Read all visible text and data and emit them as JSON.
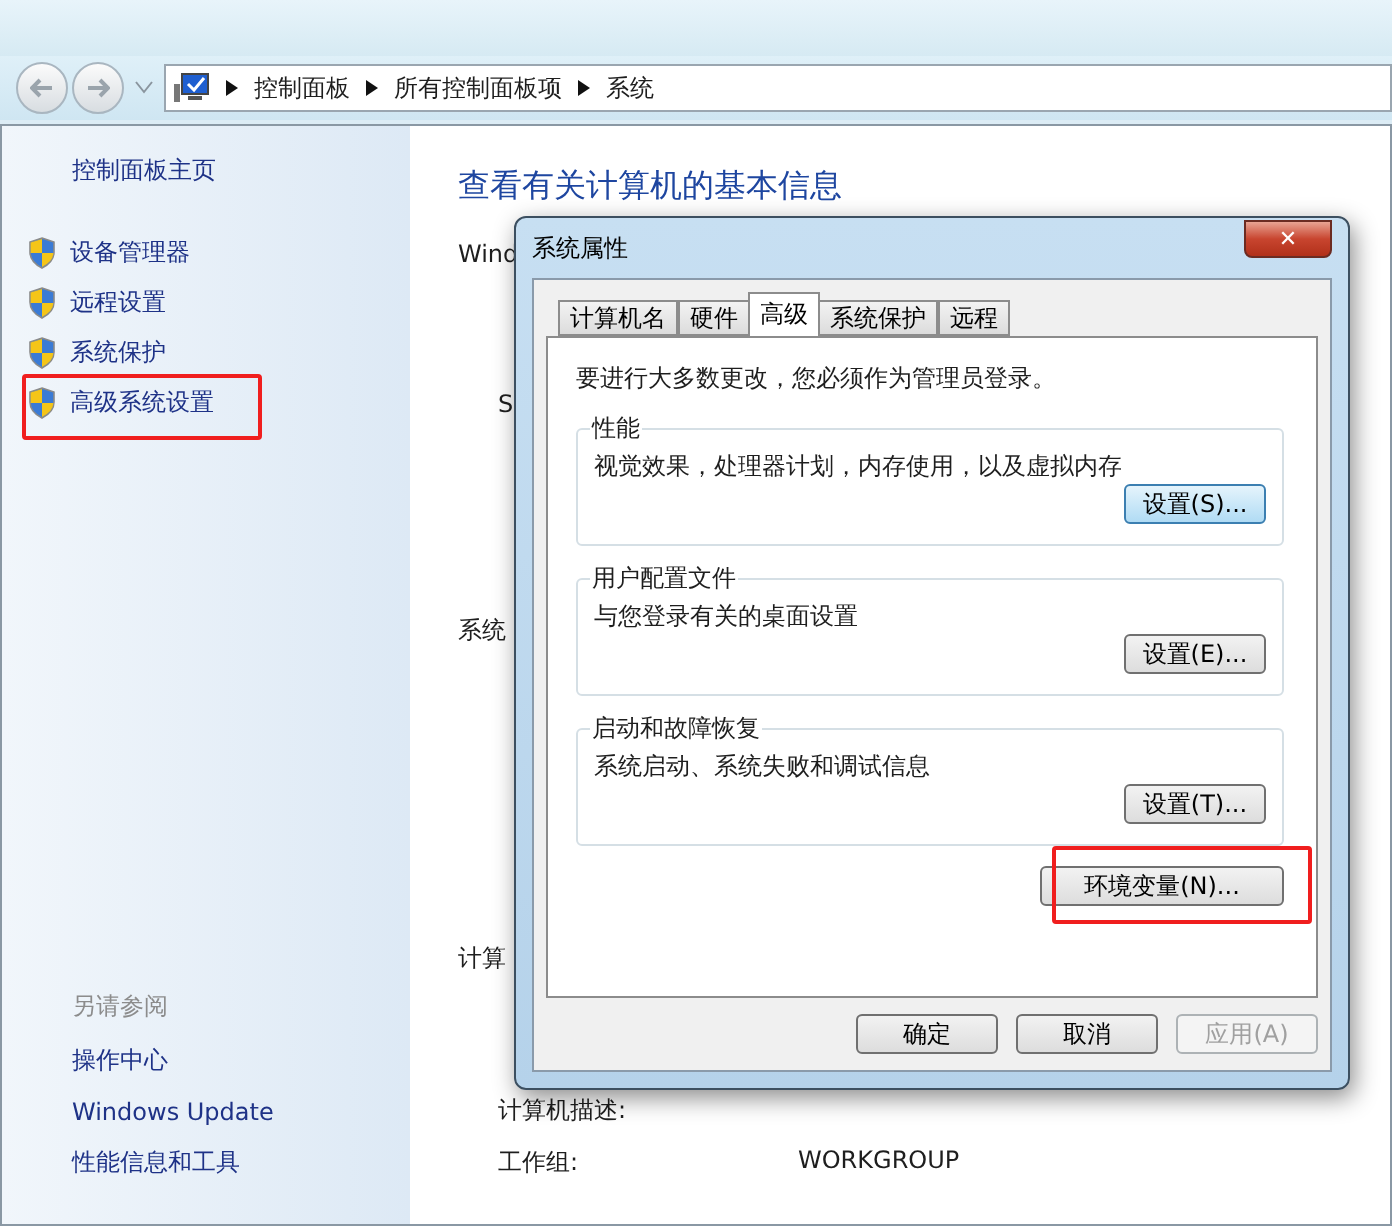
{
  "address_bar": {
    "breadcrumb": [
      "控制面板",
      "所有控制面板项",
      "系统"
    ]
  },
  "sidebar": {
    "home": "控制面板主页",
    "tasks": [
      {
        "label": "设备管理器",
        "highlighted": false
      },
      {
        "label": "远程设置",
        "highlighted": false
      },
      {
        "label": "系统保护",
        "highlighted": false
      },
      {
        "label": "高级系统设置",
        "highlighted": true
      }
    ],
    "see_also_title": "另请参阅",
    "see_also": [
      "操作中心",
      "Windows Update",
      "性能信息和工具"
    ]
  },
  "main": {
    "heading": "查看有关计算机的基本信息",
    "groups": [
      {
        "title": "Wind",
        "items": [
          {
            "label": "S"
          }
        ]
      },
      {
        "title": "系统"
      },
      {
        "title": "计算",
        "items": [
          {
            "label": "计算机描述:"
          },
          {
            "label": "工作组:",
            "value": "WORKGROUP"
          }
        ]
      }
    ]
  },
  "dialog": {
    "title": "系统属性",
    "close": "✕",
    "tabs": [
      {
        "label": "计算机名",
        "selected": false
      },
      {
        "label": "硬件",
        "selected": false
      },
      {
        "label": "高级",
        "selected": true
      },
      {
        "label": "系统保护",
        "selected": false
      },
      {
        "label": "远程",
        "selected": false
      }
    ],
    "notice": "要进行大多数更改，您必须作为管理员登录。",
    "sections": [
      {
        "title": "性能",
        "description": "视觉效果，处理器计划，内存使用，以及虚拟内存",
        "button": "设置(S)...",
        "focused": true
      },
      {
        "title": "用户配置文件",
        "description": "与您登录有关的桌面设置",
        "button": "设置(E)...",
        "focused": false
      },
      {
        "title": "启动和故障恢复",
        "description": "系统启动、系统失败和调试信息",
        "button": "设置(T)...",
        "focused": false
      }
    ],
    "env_button": {
      "label": "环境变量(N)...",
      "highlighted": true
    },
    "buttons": [
      {
        "label": "确定",
        "disabled": false
      },
      {
        "label": "取消",
        "disabled": false
      },
      {
        "label": "应用(A)",
        "disabled": true
      }
    ]
  }
}
